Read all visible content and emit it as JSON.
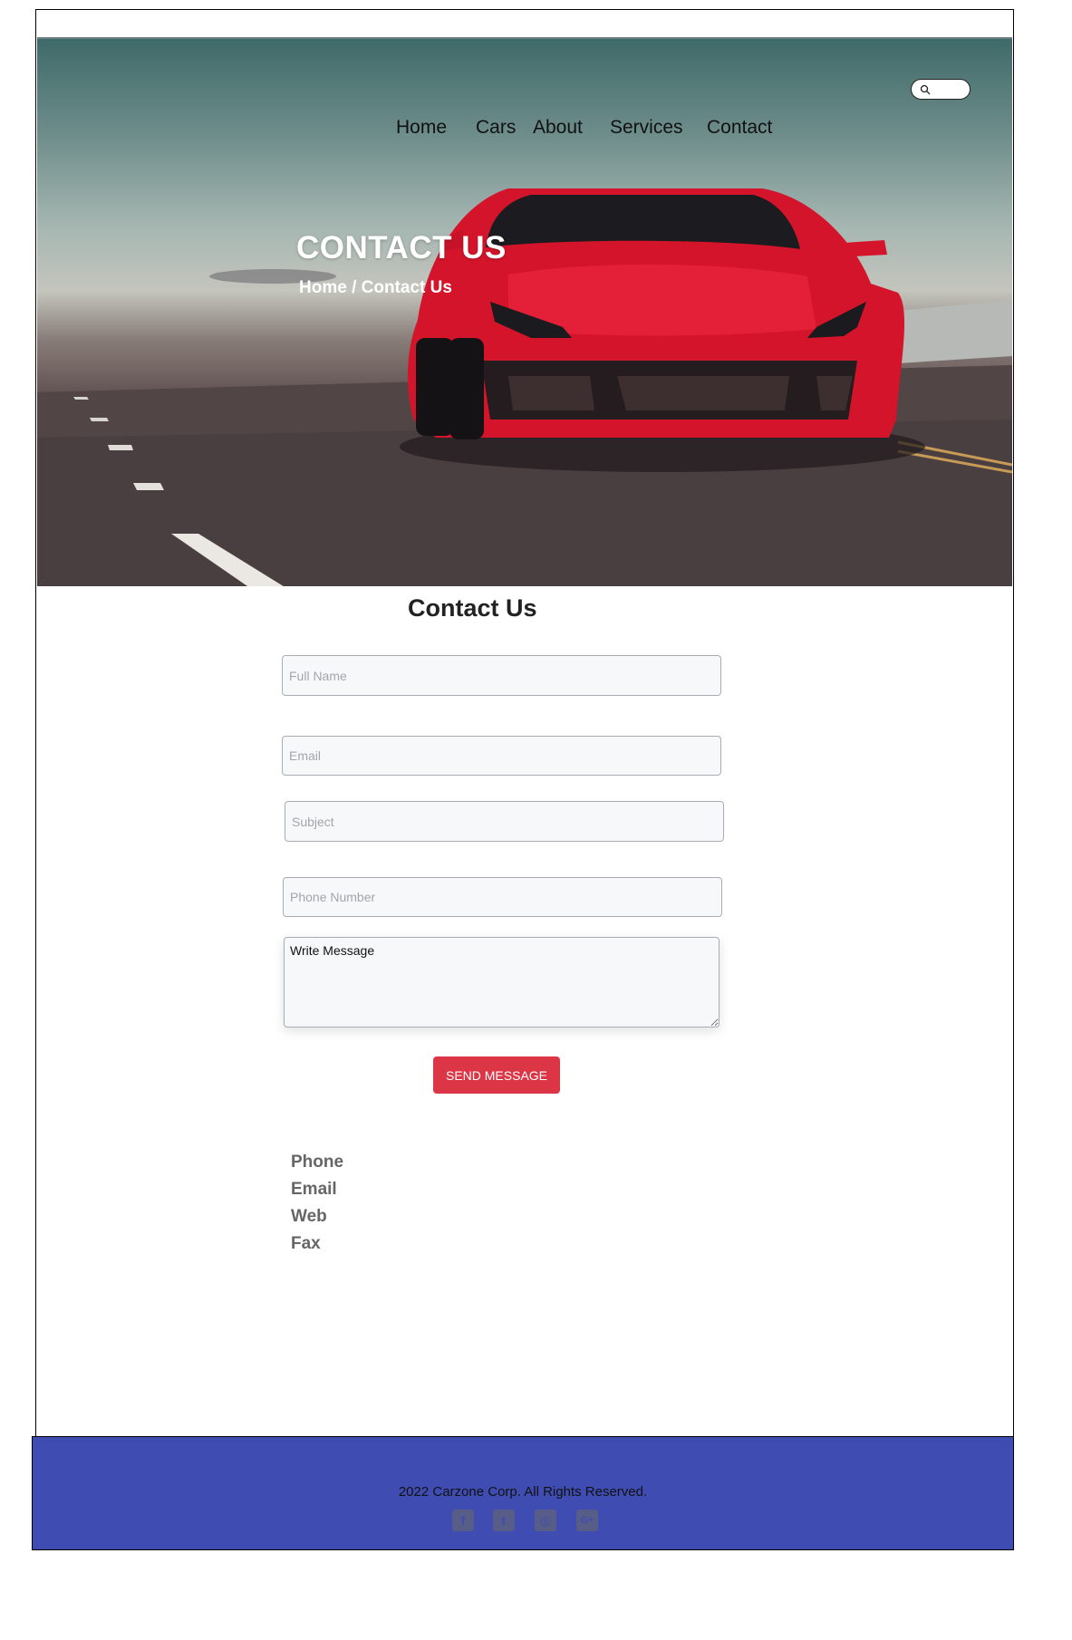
{
  "nav": {
    "items": [
      {
        "label": "Home"
      },
      {
        "label": "Cars"
      },
      {
        "label": "About"
      },
      {
        "label": "Services"
      },
      {
        "label": "Contact"
      }
    ],
    "search_placeholder": ""
  },
  "hero": {
    "title": "CONTACT US",
    "breadcrumb": "Home / Contact Us"
  },
  "contact_form": {
    "title": "Contact Us",
    "full_name_placeholder": "Full Name",
    "email_placeholder": "Email",
    "subject_placeholder": "Subject",
    "phone_placeholder": "Phone Number",
    "message_value": "Write Message",
    "send_label": "SEND MESSAGE"
  },
  "contact_info": {
    "items": [
      "Phone",
      "Email",
      "Web",
      "Fax"
    ]
  },
  "footer": {
    "copyright": "2022 Carzone Corp. All Rights Reserved.",
    "social": [
      {
        "icon": "facebook-icon",
        "glyph": "f"
      },
      {
        "icon": "twitter-icon",
        "glyph": "t"
      },
      {
        "icon": "instagram-icon",
        "glyph": "◎"
      },
      {
        "icon": "google-plus-icon",
        "glyph": "G+"
      }
    ]
  },
  "colors": {
    "accent": "#dc3545",
    "footer_bg": "#3f4db3"
  }
}
